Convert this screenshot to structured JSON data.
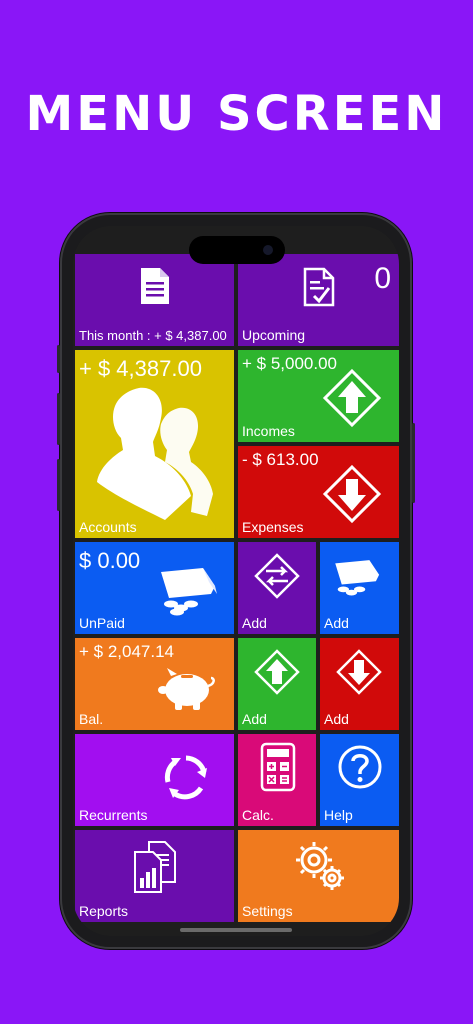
{
  "headline": "MENU SCREEN",
  "tiles": {
    "this_month": {
      "label": "This month : + $ 4,387.00",
      "color": "#6A0DAD"
    },
    "upcoming": {
      "label": "Upcoming",
      "count": "0",
      "color": "#6A0DAD"
    },
    "accounts": {
      "amount": "+ $ 4,387.00",
      "label": "Accounts",
      "color": "#D9C300"
    },
    "incomes": {
      "amount": "+ $ 5,000.00",
      "label": "Incomes",
      "color": "#2EB52E"
    },
    "expenses": {
      "amount": "- $ 613.00",
      "label": "Expenses",
      "color": "#D10A0A"
    },
    "unpaid": {
      "amount": "$ 0.00",
      "label": "UnPaid",
      "color": "#0B5CF2"
    },
    "add_transfer": {
      "label": "Add",
      "color": "#6A0DAD"
    },
    "add_unpaid": {
      "label": "Add",
      "color": "#0B5CF2"
    },
    "balance": {
      "amount": "+ $ 2,047.14",
      "label": "Bal.",
      "color": "#F07A1E"
    },
    "add_income": {
      "label": "Add",
      "color": "#2EB52E"
    },
    "add_expense": {
      "label": "Add",
      "color": "#D10A0A"
    },
    "recurrents": {
      "label": "Recurrents",
      "color": "#A20EF0"
    },
    "calc": {
      "label": "Calc.",
      "color": "#D90A78"
    },
    "help": {
      "label": "Help",
      "color": "#0B5CF2"
    },
    "reports": {
      "label": "Reports",
      "color": "#6A0DAD"
    },
    "settings": {
      "label": "Settings",
      "color": "#F07A1E"
    }
  }
}
